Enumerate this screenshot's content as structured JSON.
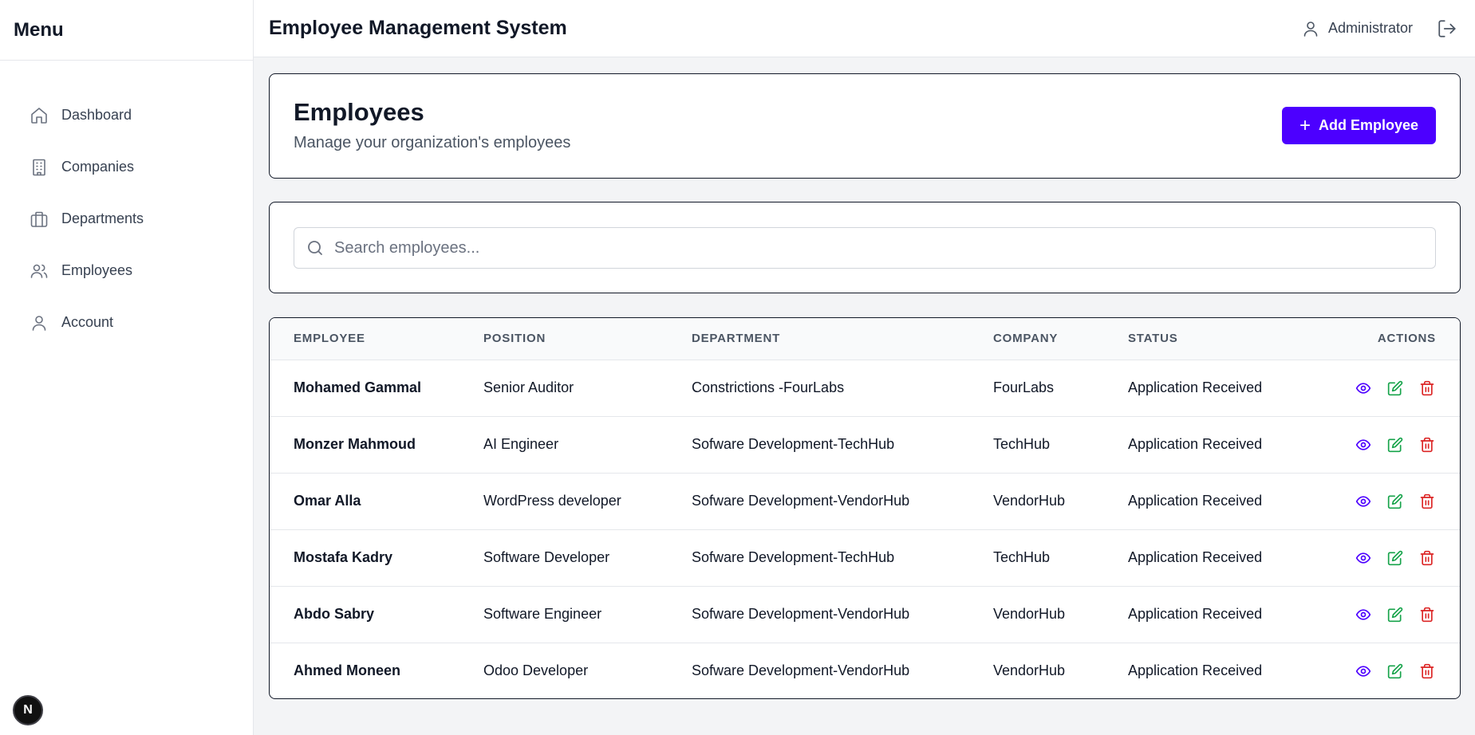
{
  "sidebar": {
    "title": "Menu",
    "items": [
      {
        "label": "Dashboard",
        "icon": "home-icon"
      },
      {
        "label": "Companies",
        "icon": "building-icon"
      },
      {
        "label": "Departments",
        "icon": "briefcase-icon"
      },
      {
        "label": "Employees",
        "icon": "users-icon"
      },
      {
        "label": "Account",
        "icon": "user-icon"
      }
    ],
    "badge": "N"
  },
  "header": {
    "app_title": "Employee Management System",
    "user_name": "Administrator"
  },
  "page": {
    "title": "Employees",
    "subtitle": "Manage your organization's employees",
    "add_button_label": "Add Employee"
  },
  "search": {
    "placeholder": "Search employees..."
  },
  "table": {
    "columns": [
      "EMPLOYEE",
      "POSITION",
      "DEPARTMENT",
      "COMPANY",
      "STATUS",
      "ACTIONS"
    ],
    "rows": [
      {
        "employee": "Mohamed Gammal",
        "position": "Senior Auditor",
        "department": "Constrictions -FourLabs",
        "company": "FourLabs",
        "status": "Application Received"
      },
      {
        "employee": "Monzer Mahmoud",
        "position": "AI Engineer",
        "department": "Sofware Development-TechHub",
        "company": "TechHub",
        "status": "Application Received"
      },
      {
        "employee": "Omar Alla",
        "position": "WordPress developer",
        "department": "Sofware Development-VendorHub",
        "company": "VendorHub",
        "status": "Application Received"
      },
      {
        "employee": "Mostafa Kadry",
        "position": "Software Developer",
        "department": "Sofware Development-TechHub",
        "company": "TechHub",
        "status": "Application Received"
      },
      {
        "employee": "Abdo Sabry",
        "position": "Software Engineer",
        "department": "Sofware Development-VendorHub",
        "company": "VendorHub",
        "status": "Application Received"
      },
      {
        "employee": "Ahmed Moneen",
        "position": "Odoo Developer",
        "department": "Sofware Development-VendorHub",
        "company": "VendorHub",
        "status": "Application Received"
      }
    ]
  },
  "colors": {
    "accent": "#4c00ff",
    "view": "#4c00ff",
    "edit": "#16a34a",
    "delete": "#dc2626"
  }
}
